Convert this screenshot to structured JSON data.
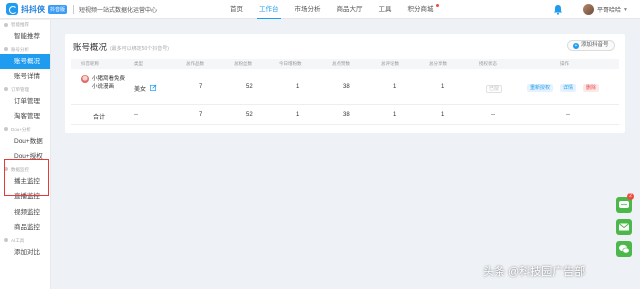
{
  "app": {
    "name": "抖抖侠",
    "badge": "抖音版",
    "tagline": "短视频一站式数据化运营中心"
  },
  "nav": {
    "items": [
      {
        "label": "首页",
        "active": false
      },
      {
        "label": "工作台",
        "active": true
      },
      {
        "label": "市场分析",
        "active": false
      },
      {
        "label": "商品大厅",
        "active": false
      },
      {
        "label": "工具",
        "active": false
      },
      {
        "label": "积分商城",
        "active": false,
        "dot": true
      }
    ]
  },
  "user": {
    "name": "平哥哈哈"
  },
  "sidebar": {
    "groups": [
      {
        "title": "智能推荐",
        "items": [
          {
            "label": "智能推荐"
          }
        ]
      },
      {
        "title": "账号分析",
        "items": [
          {
            "label": "账号概况",
            "active": true
          },
          {
            "label": "账号详情"
          }
        ]
      },
      {
        "title": "订单管理",
        "items": [
          {
            "label": "订单管理"
          },
          {
            "label": "淘客管理"
          }
        ]
      },
      {
        "title": "Dou+分析",
        "items": [
          {
            "label": "Dou+数据"
          },
          {
            "label": "Dou+授权"
          }
        ]
      },
      {
        "title": "数据监控",
        "items": [
          {
            "label": "播主监控"
          },
          {
            "label": "直播监控"
          },
          {
            "label": "视频监控"
          },
          {
            "label": "商品监控"
          }
        ]
      },
      {
        "title": "AI工具",
        "items": [
          {
            "label": "添加对比"
          }
        ]
      }
    ]
  },
  "panel": {
    "title": "账号概况",
    "subtitle": "(最多可以绑定50个抖音号)",
    "add_button": "添加抖音号",
    "columns": [
      "抖音昵称",
      "类型",
      "总作品数",
      "总粉丝数",
      "今日增粉数",
      "总点赞数",
      "总评论数",
      "总分享数",
      "授权状态",
      "操作"
    ],
    "row": {
      "name": "小猪窝看免费小说漫画",
      "type": "美女",
      "works": "7",
      "fans": "52",
      "today_fans": "1",
      "likes": "38",
      "comments": "1",
      "shares": "1",
      "auth": "已授",
      "actions": [
        "重新授权",
        "详情",
        "删除"
      ]
    },
    "total": {
      "label": "合计",
      "name_dash": "--",
      "type_dash": "--",
      "works": "7",
      "fans": "52",
      "today_fans": "1",
      "likes": "38",
      "comments": "1",
      "shares": "1",
      "auth_dash": "--",
      "actions_dash": "--"
    }
  },
  "floating": {
    "badge_count": "2"
  },
  "watermark": "头条 @科技园广告部",
  "colors": {
    "accent": "#1f9cf0",
    "highlight_border": "#e43a3a",
    "wechat_green": "#4cb84c"
  }
}
